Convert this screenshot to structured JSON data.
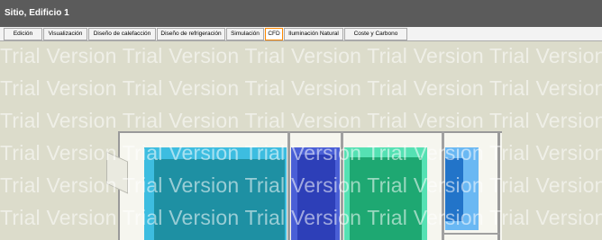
{
  "window": {
    "title": "Sitio, Edificio 1"
  },
  "tabs": [
    {
      "label": "Edición"
    },
    {
      "label": "Visualización"
    },
    {
      "label": "Diseño de calefacción"
    },
    {
      "label": "Diseño de refrigeración"
    },
    {
      "label": "Simulación"
    },
    {
      "label": "CFD",
      "active": true
    },
    {
      "label": "Iluminación Natural"
    },
    {
      "label": "Coste y Carbono"
    }
  ],
  "watermark": {
    "text": "Trial Version Trial Version Trial Version Trial Version Trial Version Trial V"
  },
  "colors": {
    "titlebar": "#5b5b5b",
    "viewport_bg": "#dcdccb",
    "active_tab_border": "#ff8a00"
  }
}
